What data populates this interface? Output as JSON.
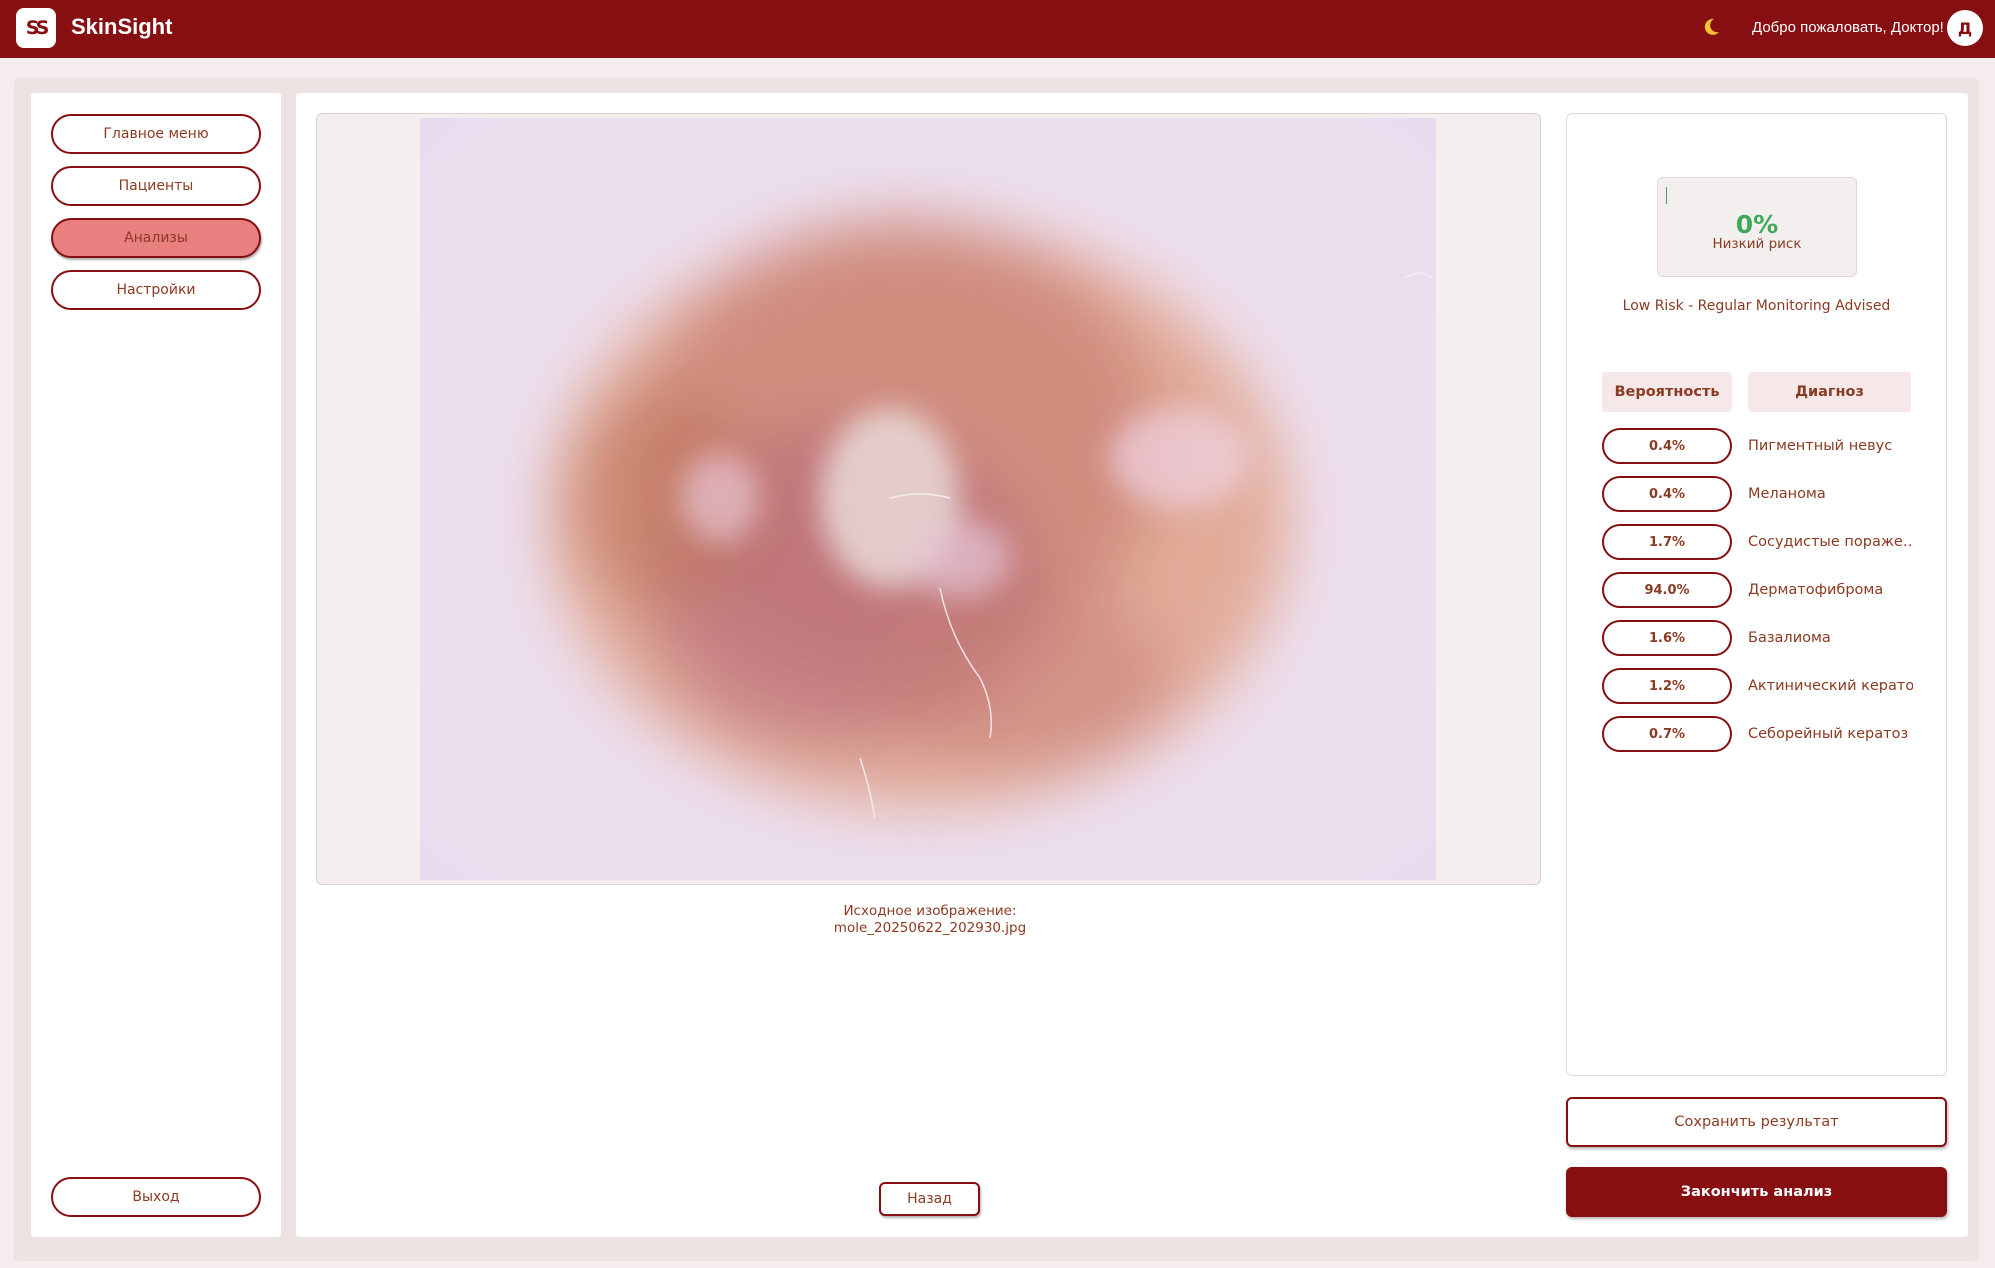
{
  "app": {
    "logo_text": "SS",
    "name": "SkinSight"
  },
  "header": {
    "theme_icon": "moon-icon",
    "welcome": "Добро пожаловать, Доктор!",
    "avatar_letter": "Д"
  },
  "sidebar": {
    "items": [
      {
        "label": "Главное меню",
        "active": false
      },
      {
        "label": "Пациенты",
        "active": false
      },
      {
        "label": "Анализы",
        "active": true
      },
      {
        "label": "Настройки",
        "active": false
      }
    ],
    "logout_label": "Выход"
  },
  "image_panel": {
    "caption_line1": "Исходное изображение:",
    "caption_line2": "mole_20250622_202930.jpg",
    "back_label": "Назад"
  },
  "results": {
    "risk_percent": "0%",
    "risk_label": "Низкий риск",
    "risk_note": "Low Risk - Regular Monitoring Advised",
    "risk_color": "#3fa95a",
    "columns": {
      "probability": "Вероятность",
      "diagnosis": "Диагноз"
    },
    "rows": [
      {
        "probability": "0.4%",
        "diagnosis": "Пигментный невус"
      },
      {
        "probability": "0.4%",
        "diagnosis": "Меланома"
      },
      {
        "probability": "1.7%",
        "diagnosis": "Сосудистые пораже…"
      },
      {
        "probability": "94.0%",
        "diagnosis": "Дерматофиброма"
      },
      {
        "probability": "1.6%",
        "diagnosis": "Базалиома"
      },
      {
        "probability": "1.2%",
        "diagnosis": "Актинический кератоз"
      },
      {
        "probability": "0.7%",
        "diagnosis": "Себорейный кератоз"
      }
    ]
  },
  "actions": {
    "save_label": "Сохранить результат",
    "finish_label": "Закончить анализ"
  },
  "colors": {
    "brand": "#870e11",
    "active_nav": "#e98080",
    "text": "#8a3b22"
  }
}
